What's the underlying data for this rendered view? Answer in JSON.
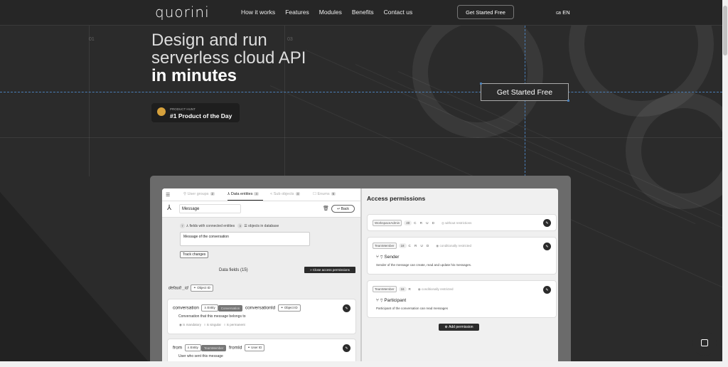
{
  "header": {
    "logo": "quorini",
    "nav": [
      "How it works",
      "Features",
      "Modules",
      "Benefits",
      "Contact us"
    ],
    "cta": "Get Started Free",
    "lang_flag": "GB",
    "lang": "EN"
  },
  "hero": {
    "title_line1": "Design and run",
    "title_line2": "serverless cloud API",
    "title_line3": "in minutes",
    "cta": "Get Started Free",
    "badge_small": "PRODUCT HUNT",
    "badge_big": "#1 Product of the Day",
    "deco_num_1": "01",
    "deco_num_2": "03"
  },
  "app": {
    "tabs": [
      {
        "label": "User groups",
        "count": "2"
      },
      {
        "label": "Data entities",
        "count": "4"
      },
      {
        "label": "Sub objects",
        "count": "4"
      },
      {
        "label": "Enums",
        "count": "6"
      }
    ],
    "entity_name": "Message",
    "back_label": "Back",
    "stats": {
      "fields_count": "7",
      "fields_label": "fields with connected entities",
      "objects_count": "3",
      "objects_label": "objects in database"
    },
    "description": "Message of the conversation",
    "track_changes": "Track changes",
    "data_fields_title": "Data fields (15)",
    "close_permissions": "Close access permissions",
    "id_field": "default _id",
    "id_tag": "Object ID",
    "fields": [
      {
        "name": "conversation",
        "entity_tag": "Entity",
        "entity_value": "Conversation",
        "id_name": "conversationId",
        "id_tag": "Object ID",
        "desc": "Conversation that this message belongs to",
        "flags": [
          "is mandatory",
          "is singular",
          "is permanent"
        ]
      },
      {
        "name": "from",
        "entity_tag": "Entity",
        "entity_value": "TeamMember",
        "id_name": "fromId",
        "id_tag": "User ID",
        "desc": "User who sent this message"
      }
    ],
    "access": {
      "title": "Access permissions",
      "perms": [
        {
          "role": "WorkspaceAdmin",
          "count": "40",
          "crud": "C R U D",
          "restriction": "without restrictions"
        },
        {
          "role": "TeamMember",
          "count": "18",
          "crud": "C R U D",
          "restriction": "conditionally restricted",
          "name": "Sender",
          "desc": "Sender of the message can create, read and update his messages."
        },
        {
          "role": "TeamMember",
          "count": "16",
          "crud": "R",
          "restriction": "conditionally restricted",
          "name": "Participant",
          "desc": "Participant of the conversation can read messages"
        }
      ],
      "add": "Add permission"
    }
  }
}
